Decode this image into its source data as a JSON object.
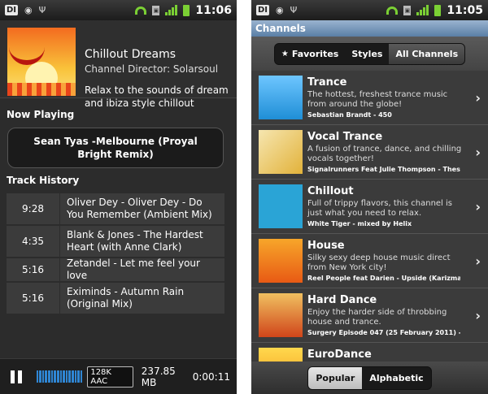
{
  "left": {
    "status": {
      "logo": "DI",
      "time": "11:06",
      "icons": [
        "android-icon",
        "usb-icon",
        "wifi-icon",
        "sdcard-icon",
        "signal-icon",
        "battery-icon"
      ]
    },
    "channel": {
      "title": "Chillout Dreams",
      "director": "Channel Director: Solarsoul",
      "description": "Relax to the sounds of dream and ibiza style chillout"
    },
    "now_playing_label": "Now Playing",
    "now_playing": "Sean Tyas -Melbourne (Proyal Bright Remix)",
    "history_label": "Track History",
    "history": [
      {
        "time": "9:28",
        "track": "Oliver Dey - Oliver Dey - Do You Remember (Ambient Mix)"
      },
      {
        "time": "4:35",
        "track": "Blank & Jones - The Hardest Heart (with Anne Clark)"
      },
      {
        "time": "5:16",
        "track": "Zetandel - Let me feel your love"
      },
      {
        "time": "5:16",
        "track": "Eximinds - Autumn Rain (Original Mix)"
      }
    ],
    "player": {
      "bitrate": "128K AAC",
      "size": "237.85 MB",
      "elapsed": "0:00:11",
      "buffer_level": 1.0
    }
  },
  "right": {
    "status": {
      "logo": "DI",
      "time": "11:05"
    },
    "title": "Channels",
    "tabs": [
      {
        "label": "Favorites",
        "icon": "star-icon",
        "active": false
      },
      {
        "label": "Styles",
        "active": false
      },
      {
        "label": "All Channels",
        "active": true
      }
    ],
    "channels": [
      {
        "name": "Trance",
        "description": "The hottest, freshest trance music from around the globe!",
        "track": "Sebastian Brandt - 450"
      },
      {
        "name": "Vocal Trance",
        "description": "A fusion of trance, dance, and chilling vocals together!",
        "track": "Signalrunners Feat Julie Thompson - These"
      },
      {
        "name": "Chillout",
        "description": "Full of trippy flavors, this channel is just what you need to relax.",
        "track": "White Tiger - mixed by Helix"
      },
      {
        "name": "House",
        "description": "Silky sexy deep house music direct from New York city!",
        "track": "Reel People feat Darien - Upside (Karizma's"
      },
      {
        "name": "Hard Dance",
        "description": "Enjoy the harder side of throbbing house and trance.",
        "track": "Surgery Episode 047 (25 February 2011) -"
      },
      {
        "name": "EuroDance",
        "description": "",
        "track": ""
      }
    ],
    "bottom_tabs": [
      {
        "label": "Popular",
        "active": true
      },
      {
        "label": "Alphabetic",
        "active": false
      }
    ]
  }
}
